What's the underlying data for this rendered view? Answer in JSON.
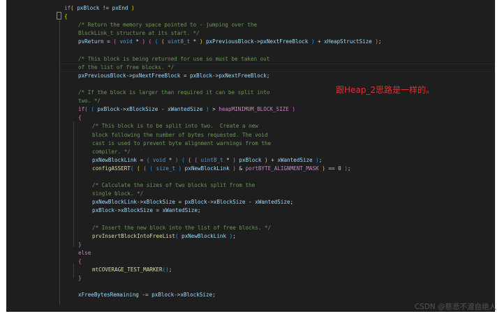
{
  "code_lines": [
    {
      "indent": 0,
      "tokens": [
        [
          "kw",
          "if"
        ],
        [
          "br1",
          "( "
        ],
        [
          "var",
          "pxBlock"
        ],
        [
          "op",
          " != "
        ],
        [
          "var",
          "pxEnd"
        ],
        [
          "br1",
          " )"
        ]
      ]
    },
    {
      "indent": 0,
      "tokens": [
        [
          "br1",
          "{"
        ]
      ]
    },
    {
      "indent": 1,
      "tokens": [
        [
          "cmt",
          "/* Return the memory space pointed to - jumping over the"
        ]
      ]
    },
    {
      "indent": 1,
      "tokens": [
        [
          "cmt",
          "BlockLink_t structure at its start. */"
        ]
      ]
    },
    {
      "indent": 1,
      "tokens": [
        [
          "var",
          "pvReturn"
        ],
        [
          "op",
          " = "
        ],
        [
          "br2",
          "( "
        ],
        [
          "type",
          "void"
        ],
        [
          "op",
          " * "
        ],
        [
          "br2",
          ")"
        ],
        [
          "op",
          " "
        ],
        [
          "br2",
          "( "
        ],
        [
          "br3",
          "( "
        ],
        [
          "br1",
          "( "
        ],
        [
          "type",
          "uint8_t"
        ],
        [
          "op",
          " * "
        ],
        [
          "br1",
          ")"
        ],
        [
          "op",
          " "
        ],
        [
          "var",
          "pxPreviousBlock"
        ],
        [
          "op",
          "->"
        ],
        [
          "var",
          "pxNextFreeBlock"
        ],
        [
          "br3",
          " )"
        ],
        [
          "op",
          " + "
        ],
        [
          "var",
          "xHeapStructSize"
        ],
        [
          "br2",
          " )"
        ],
        [
          "op",
          ";"
        ]
      ]
    },
    {
      "indent": 1,
      "tokens": []
    },
    {
      "indent": 1,
      "tokens": [
        [
          "cmt",
          "/* This block is being returned for use so must be taken out"
        ]
      ]
    },
    {
      "indent": 1,
      "tokens": [
        [
          "cmt",
          "of the list of free blocks. */"
        ]
      ]
    },
    {
      "indent": 1,
      "tokens": [
        [
          "var",
          "pxPreviousBlock"
        ],
        [
          "op",
          "->"
        ],
        [
          "var",
          "pxNextFreeBlock"
        ],
        [
          "op",
          " = "
        ],
        [
          "var",
          "pxBlock"
        ],
        [
          "op",
          "->"
        ],
        [
          "var",
          "pxNextFreeBlock"
        ],
        [
          "op",
          ";"
        ]
      ]
    },
    {
      "indent": 1,
      "tokens": []
    },
    {
      "indent": 1,
      "tokens": [
        [
          "cmt",
          "/* If the block is larger than required it can be split into"
        ]
      ]
    },
    {
      "indent": 1,
      "tokens": [
        [
          "cmt",
          "two. */"
        ]
      ]
    },
    {
      "indent": 1,
      "tokens": [
        [
          "kw",
          "if"
        ],
        [
          "br2",
          "( "
        ],
        [
          "br3",
          "( "
        ],
        [
          "var",
          "pxBlock"
        ],
        [
          "op",
          "->"
        ],
        [
          "var",
          "xBlockSize"
        ],
        [
          "op",
          " - "
        ],
        [
          "var",
          "xWantedSize"
        ],
        [
          "br3",
          " )"
        ],
        [
          "op",
          " > "
        ],
        [
          "macro",
          "heapMINIMUM_BLOCK_SIZE"
        ],
        [
          "br2",
          " )"
        ]
      ]
    },
    {
      "indent": 1,
      "tokens": [
        [
          "br2",
          "{"
        ]
      ]
    },
    {
      "indent": 2,
      "tokens": [
        [
          "cmt",
          "/* This block is to be split into two.  Create a new"
        ]
      ]
    },
    {
      "indent": 2,
      "tokens": [
        [
          "cmt",
          "block following the number of bytes requested. The void"
        ]
      ]
    },
    {
      "indent": 2,
      "tokens": [
        [
          "cmt",
          "cast is used to prevent byte alignment warnings from the"
        ]
      ]
    },
    {
      "indent": 2,
      "tokens": [
        [
          "cmt",
          "compiler. */"
        ]
      ]
    },
    {
      "indent": 2,
      "tokens": [
        [
          "var",
          "pxNewBlockLink"
        ],
        [
          "op",
          " = "
        ],
        [
          "br3",
          "( "
        ],
        [
          "type",
          "void"
        ],
        [
          "op",
          " * "
        ],
        [
          "br3",
          ")"
        ],
        [
          "op",
          " "
        ],
        [
          "br3",
          "( "
        ],
        [
          "br1",
          "( "
        ],
        [
          "br2",
          "( "
        ],
        [
          "type",
          "uint8_t"
        ],
        [
          "op",
          " * "
        ],
        [
          "br2",
          ")"
        ],
        [
          "op",
          " "
        ],
        [
          "var",
          "pxBlock"
        ],
        [
          "br1",
          " )"
        ],
        [
          "op",
          " + "
        ],
        [
          "var",
          "xWantedSize"
        ],
        [
          "br3",
          " )"
        ],
        [
          "op",
          ";"
        ]
      ]
    },
    {
      "indent": 2,
      "tokens": [
        [
          "fn",
          "configASSERT"
        ],
        [
          "br3",
          "( "
        ],
        [
          "br1",
          "( "
        ],
        [
          "br2",
          "( "
        ],
        [
          "br3",
          "( "
        ],
        [
          "type",
          "size_t"
        ],
        [
          "br3",
          " )"
        ],
        [
          "op",
          " "
        ],
        [
          "var",
          "pxNewBlockLink"
        ],
        [
          "br2",
          " )"
        ],
        [
          "op",
          " & "
        ],
        [
          "macro",
          "portBYTE_ALIGNMENT_MASK"
        ],
        [
          "br1",
          " )"
        ],
        [
          "op",
          " == "
        ],
        [
          "num",
          "0"
        ],
        [
          "br3",
          " )"
        ],
        [
          "op",
          ";"
        ]
      ]
    },
    {
      "indent": 2,
      "tokens": []
    },
    {
      "indent": 2,
      "tokens": [
        [
          "cmt",
          "/* Calculate the sizes of two blocks split from the"
        ]
      ]
    },
    {
      "indent": 2,
      "tokens": [
        [
          "cmt",
          "single block. */"
        ]
      ]
    },
    {
      "indent": 2,
      "tokens": [
        [
          "var",
          "pxNewBlockLink"
        ],
        [
          "op",
          "->"
        ],
        [
          "var",
          "xBlockSize"
        ],
        [
          "op",
          " = "
        ],
        [
          "var",
          "pxBlock"
        ],
        [
          "op",
          "->"
        ],
        [
          "var",
          "xBlockSize"
        ],
        [
          "op",
          " - "
        ],
        [
          "var",
          "xWantedSize"
        ],
        [
          "op",
          ";"
        ]
      ]
    },
    {
      "indent": 2,
      "tokens": [
        [
          "var",
          "pxBlock"
        ],
        [
          "op",
          "->"
        ],
        [
          "var",
          "xBlockSize"
        ],
        [
          "op",
          " = "
        ],
        [
          "var",
          "xWantedSize"
        ],
        [
          "op",
          ";"
        ]
      ]
    },
    {
      "indent": 2,
      "tokens": []
    },
    {
      "indent": 2,
      "tokens": [
        [
          "cmt",
          "/* Insert the new block into the list of free blocks. */"
        ]
      ]
    },
    {
      "indent": 2,
      "tokens": [
        [
          "fn",
          "prvInsertBlockIntoFreeList"
        ],
        [
          "br3",
          "( "
        ],
        [
          "var",
          "pxNewBlockLink"
        ],
        [
          "br3",
          " )"
        ],
        [
          "op",
          ";"
        ]
      ]
    },
    {
      "indent": 1,
      "tokens": [
        [
          "br2",
          "}"
        ]
      ]
    },
    {
      "indent": 1,
      "tokens": [
        [
          "kw",
          "else"
        ]
      ]
    },
    {
      "indent": 1,
      "tokens": [
        [
          "br2",
          "{"
        ]
      ]
    },
    {
      "indent": 2,
      "tokens": [
        [
          "fn",
          "mtCOVERAGE_TEST_MARKER"
        ],
        [
          "br3",
          "()"
        ],
        [
          "op",
          ";"
        ]
      ]
    },
    {
      "indent": 1,
      "tokens": [
        [
          "br2",
          "}"
        ]
      ]
    },
    {
      "indent": 1,
      "tokens": []
    },
    {
      "indent": 1,
      "tokens": [
        [
          "var",
          "xFreeBytesRemaining"
        ],
        [
          "op",
          " -= "
        ],
        [
          "var",
          "pxBlock"
        ],
        [
          "op",
          "->"
        ],
        [
          "var",
          "xBlockSize"
        ],
        [
          "op",
          ";"
        ]
      ]
    }
  ],
  "annotation": "跟Heap_2思路是一样的。",
  "watermark": "CSDN @慈悲不渡自绝人",
  "colors": {
    "editor_bg": "#1e1e1e",
    "keyword": "#c586c0",
    "type": "#569cd6",
    "variable": "#9cdcfe",
    "function": "#dcdcaa",
    "comment": "#6a9955",
    "annotation": "#e03131"
  }
}
